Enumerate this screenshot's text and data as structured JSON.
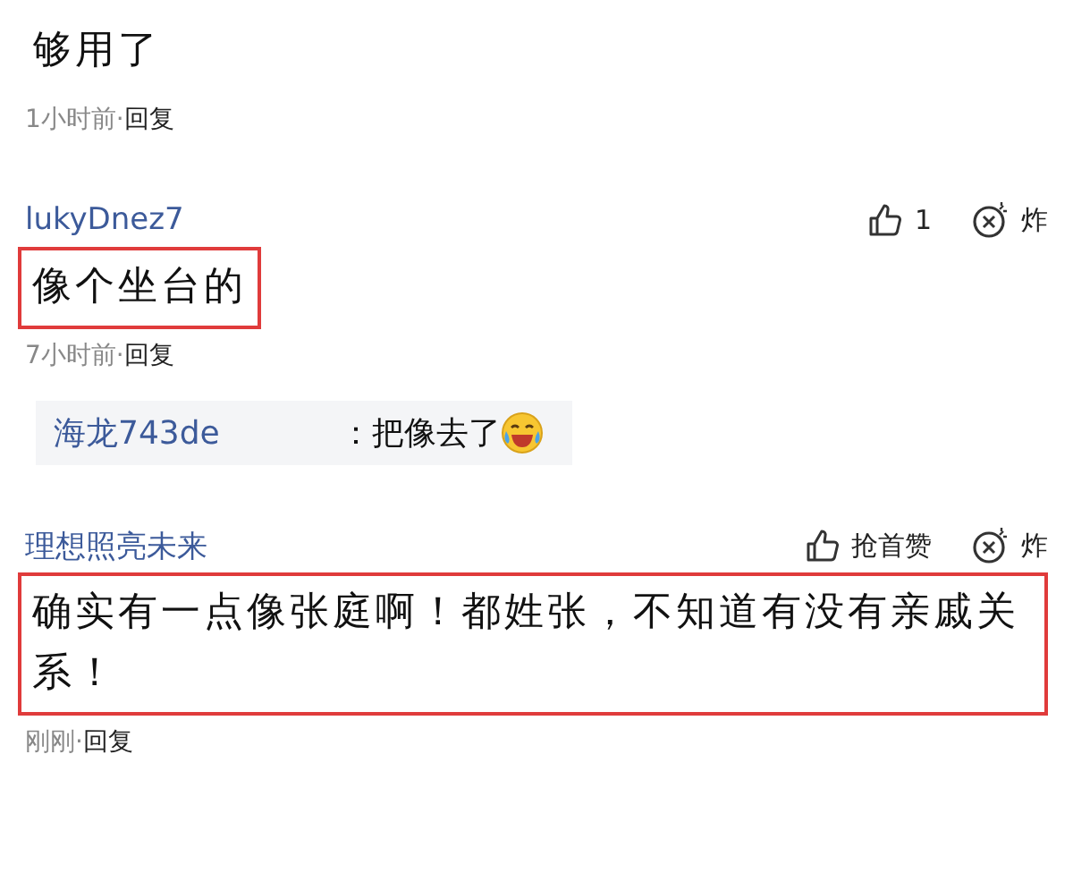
{
  "comments": [
    {
      "text": "够用了",
      "highlighted": false,
      "time": "1小时前",
      "separator": "·",
      "reply_label": "回复"
    },
    {
      "author": "lukyDnez7",
      "like_label": "1",
      "bomb_label": "炸",
      "text": "像个坐台的",
      "highlighted": true,
      "time": "7小时前",
      "separator": "·",
      "reply_label": "回复",
      "replies": [
        {
          "author": "海龙743de",
          "text": "：把像去了",
          "emoji": true
        }
      ]
    },
    {
      "author": "理想照亮未来",
      "like_label": "抢首赞",
      "bomb_label": "炸",
      "text": "确实有一点像张庭啊！都姓张，不知道有没有亲戚关系！",
      "highlighted": true,
      "time": "刚刚",
      "separator": "·",
      "reply_label": "回复"
    }
  ]
}
